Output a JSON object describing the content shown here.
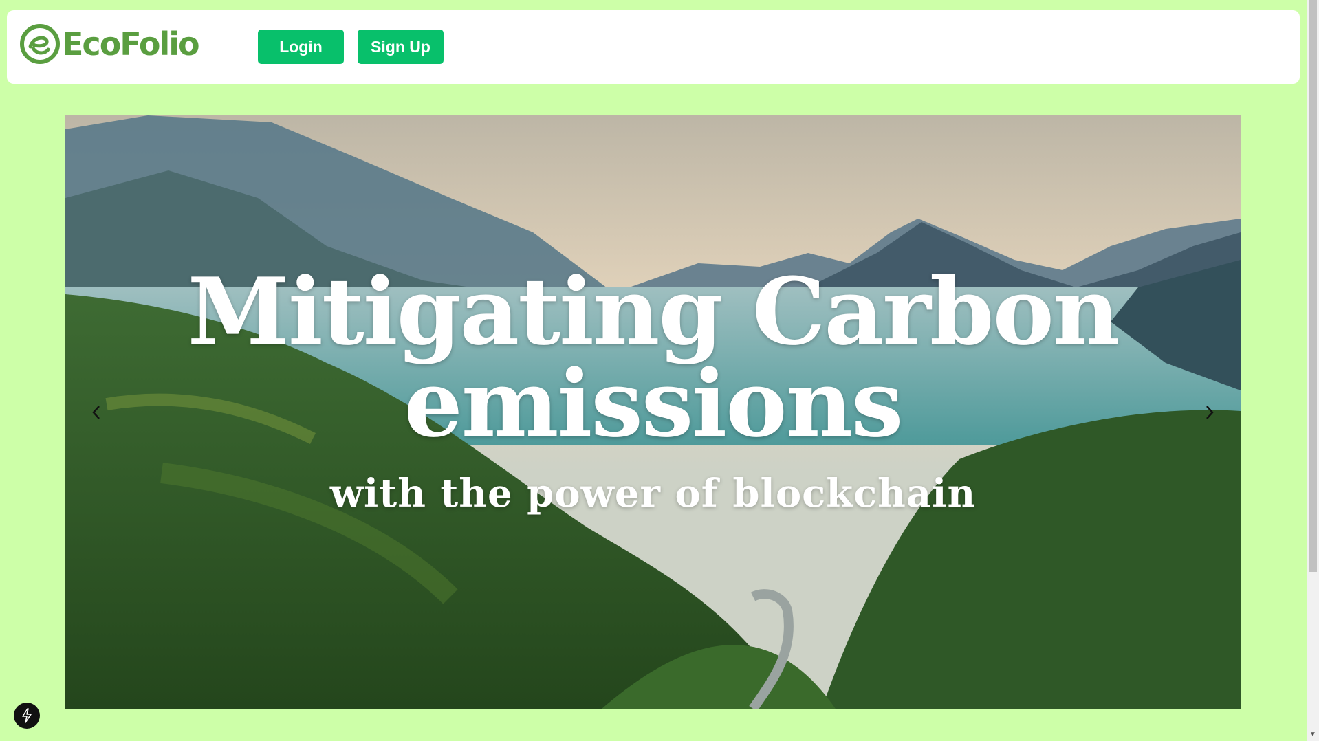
{
  "brand": {
    "name": "EcoFolio",
    "color": "#5a9e40"
  },
  "nav": {
    "login_label": "Login",
    "signup_label": "Sign Up",
    "button_color": "#08c06b"
  },
  "hero": {
    "line1": "Mitigating Carbon",
    "line2": "emissions",
    "line3": "with the power of blockchain",
    "prev_icon": "chevron-left-icon",
    "next_icon": "chevron-right-icon"
  },
  "page": {
    "background": "#cdffa8"
  },
  "floating": {
    "icon": "lightning-bolt-icon"
  }
}
